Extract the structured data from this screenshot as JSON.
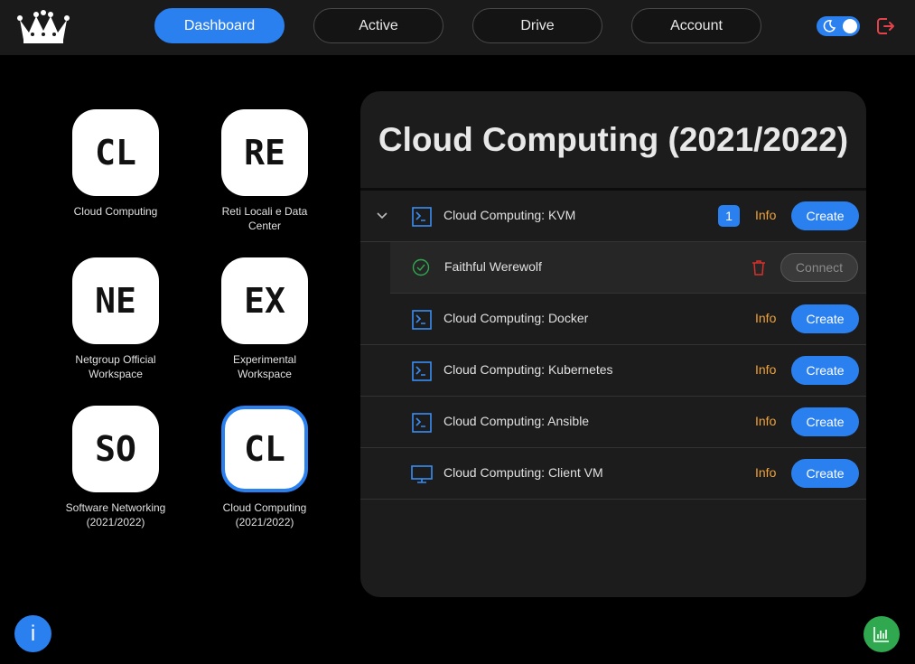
{
  "colors": {
    "accent": "#2b80f0",
    "info_link": "#f0a33a",
    "success": "#2fa84f",
    "danger": "#d9302a"
  },
  "nav": {
    "tabs": [
      {
        "label": "Dashboard",
        "active": true
      },
      {
        "label": "Active",
        "active": false
      },
      {
        "label": "Drive",
        "active": false
      },
      {
        "label": "Account",
        "active": false
      }
    ],
    "theme_toggle": "dark",
    "logout_icon": "logout-icon",
    "logo_icon": "crown-icon"
  },
  "workspaces": [
    {
      "abbr": "CL",
      "label": "Cloud Computing",
      "selected": false
    },
    {
      "abbr": "RE",
      "label": "Reti Locali e Data Center",
      "selected": false
    },
    {
      "abbr": "NE",
      "label": "Netgroup Official Workspace",
      "selected": false
    },
    {
      "abbr": "EX",
      "label": "Experimental Workspace",
      "selected": false
    },
    {
      "abbr": "SO",
      "label": "Software Networking (2021/2022)",
      "selected": false
    },
    {
      "abbr": "CL",
      "label": "Cloud Computing (2021/2022)",
      "selected": true
    }
  ],
  "panel": {
    "title": "Cloud Computing (2021/2022)",
    "templates": [
      {
        "name": "Cloud Computing: KVM",
        "icon": "terminal-icon",
        "count": "1",
        "info": "Info",
        "create": "Create",
        "expanded": true
      },
      {
        "name": "Cloud Computing: Docker",
        "icon": "terminal-icon",
        "info": "Info",
        "create": "Create"
      },
      {
        "name": "Cloud Computing: Kubernetes",
        "icon": "terminal-icon",
        "info": "Info",
        "create": "Create"
      },
      {
        "name": "Cloud Computing: Ansible",
        "icon": "terminal-icon",
        "info": "Info",
        "create": "Create"
      },
      {
        "name": "Cloud Computing: Client VM",
        "icon": "monitor-icon",
        "info": "Info",
        "create": "Create"
      }
    ],
    "instance": {
      "name": "Faithful Werewolf",
      "status": "ready",
      "connect": "Connect"
    }
  },
  "fabs": {
    "info": "i",
    "stats_icon": "bar-chart-icon"
  }
}
